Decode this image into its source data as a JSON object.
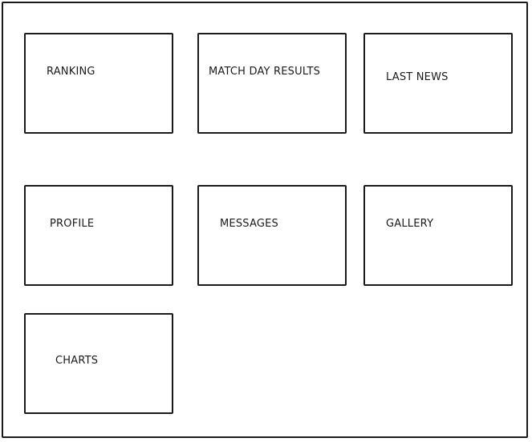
{
  "tiles": {
    "ranking": "RANKING",
    "match_day_results": "MATCH DAY RESULTS",
    "last_news": "LAST NEWS",
    "profile": "PROFILE",
    "messages": "MESSAGES",
    "gallery": "GALLERY",
    "charts": "CHARTS"
  },
  "colors": {
    "stroke": "#1a1a1a",
    "background": "#ffffff"
  }
}
